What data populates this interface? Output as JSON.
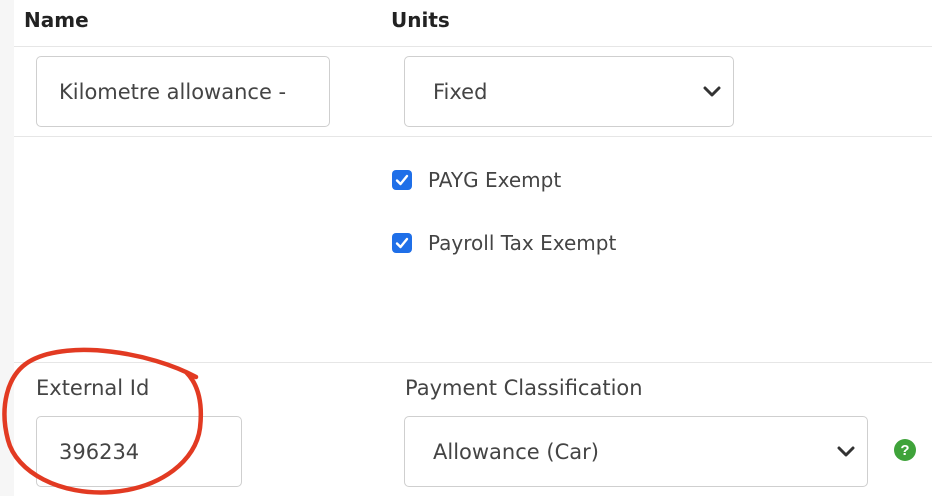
{
  "columns": {
    "name_header": "Name",
    "units_header": "Units"
  },
  "name_field": {
    "value": "Kilometre allowance - "
  },
  "units_select": {
    "value": "Fixed"
  },
  "checkboxes": [
    {
      "label": "PAYG Exempt",
      "checked": true
    },
    {
      "label": "Payroll Tax Exempt",
      "checked": true
    }
  ],
  "external_id": {
    "label": "External Id",
    "value": "396234"
  },
  "payment_classification": {
    "label": "Payment Classification",
    "value": "Allowance (Car)"
  },
  "help_icon": {
    "symbol": "?",
    "color": "#3fa33a"
  },
  "colors": {
    "checkbox": "#1f6fe8",
    "annotation": "#e23a22"
  }
}
